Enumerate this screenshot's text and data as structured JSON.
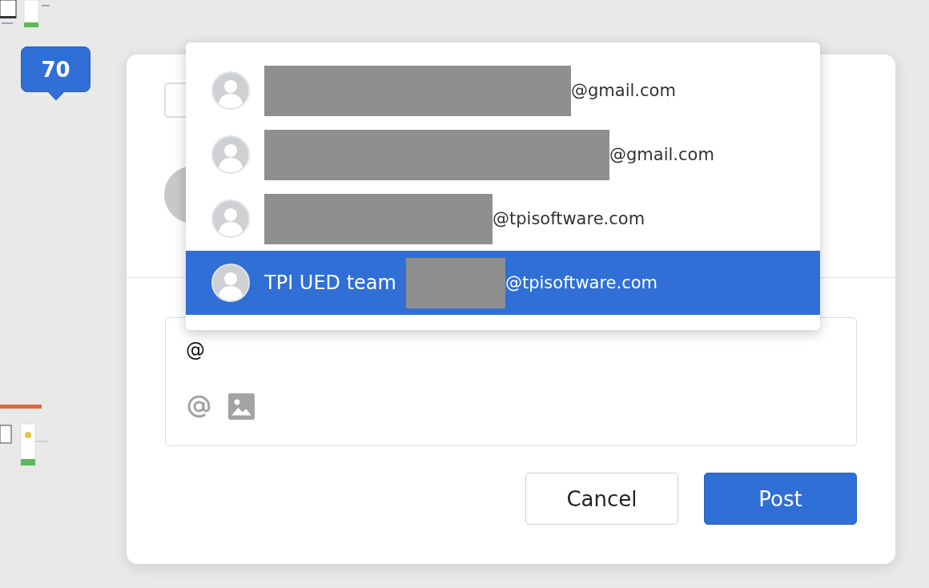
{
  "step_badge": {
    "label": "70"
  },
  "mention_menu": {
    "items": [
      {
        "redacted": true,
        "email": "@gmail.com",
        "selected": false
      },
      {
        "redacted": true,
        "email": "@gmail.com",
        "selected": false
      },
      {
        "redacted": true,
        "email": "@tpisoftware.com",
        "selected": false
      },
      {
        "name": "TPI UED team",
        "redacted": true,
        "email": "@tpisoftware.com",
        "selected": true
      }
    ]
  },
  "comment_box": {
    "value": "@"
  },
  "buttons": [
    {
      "label": "Cancel",
      "kind": "secondary"
    },
    {
      "label": "Post",
      "kind": "primary"
    }
  ]
}
